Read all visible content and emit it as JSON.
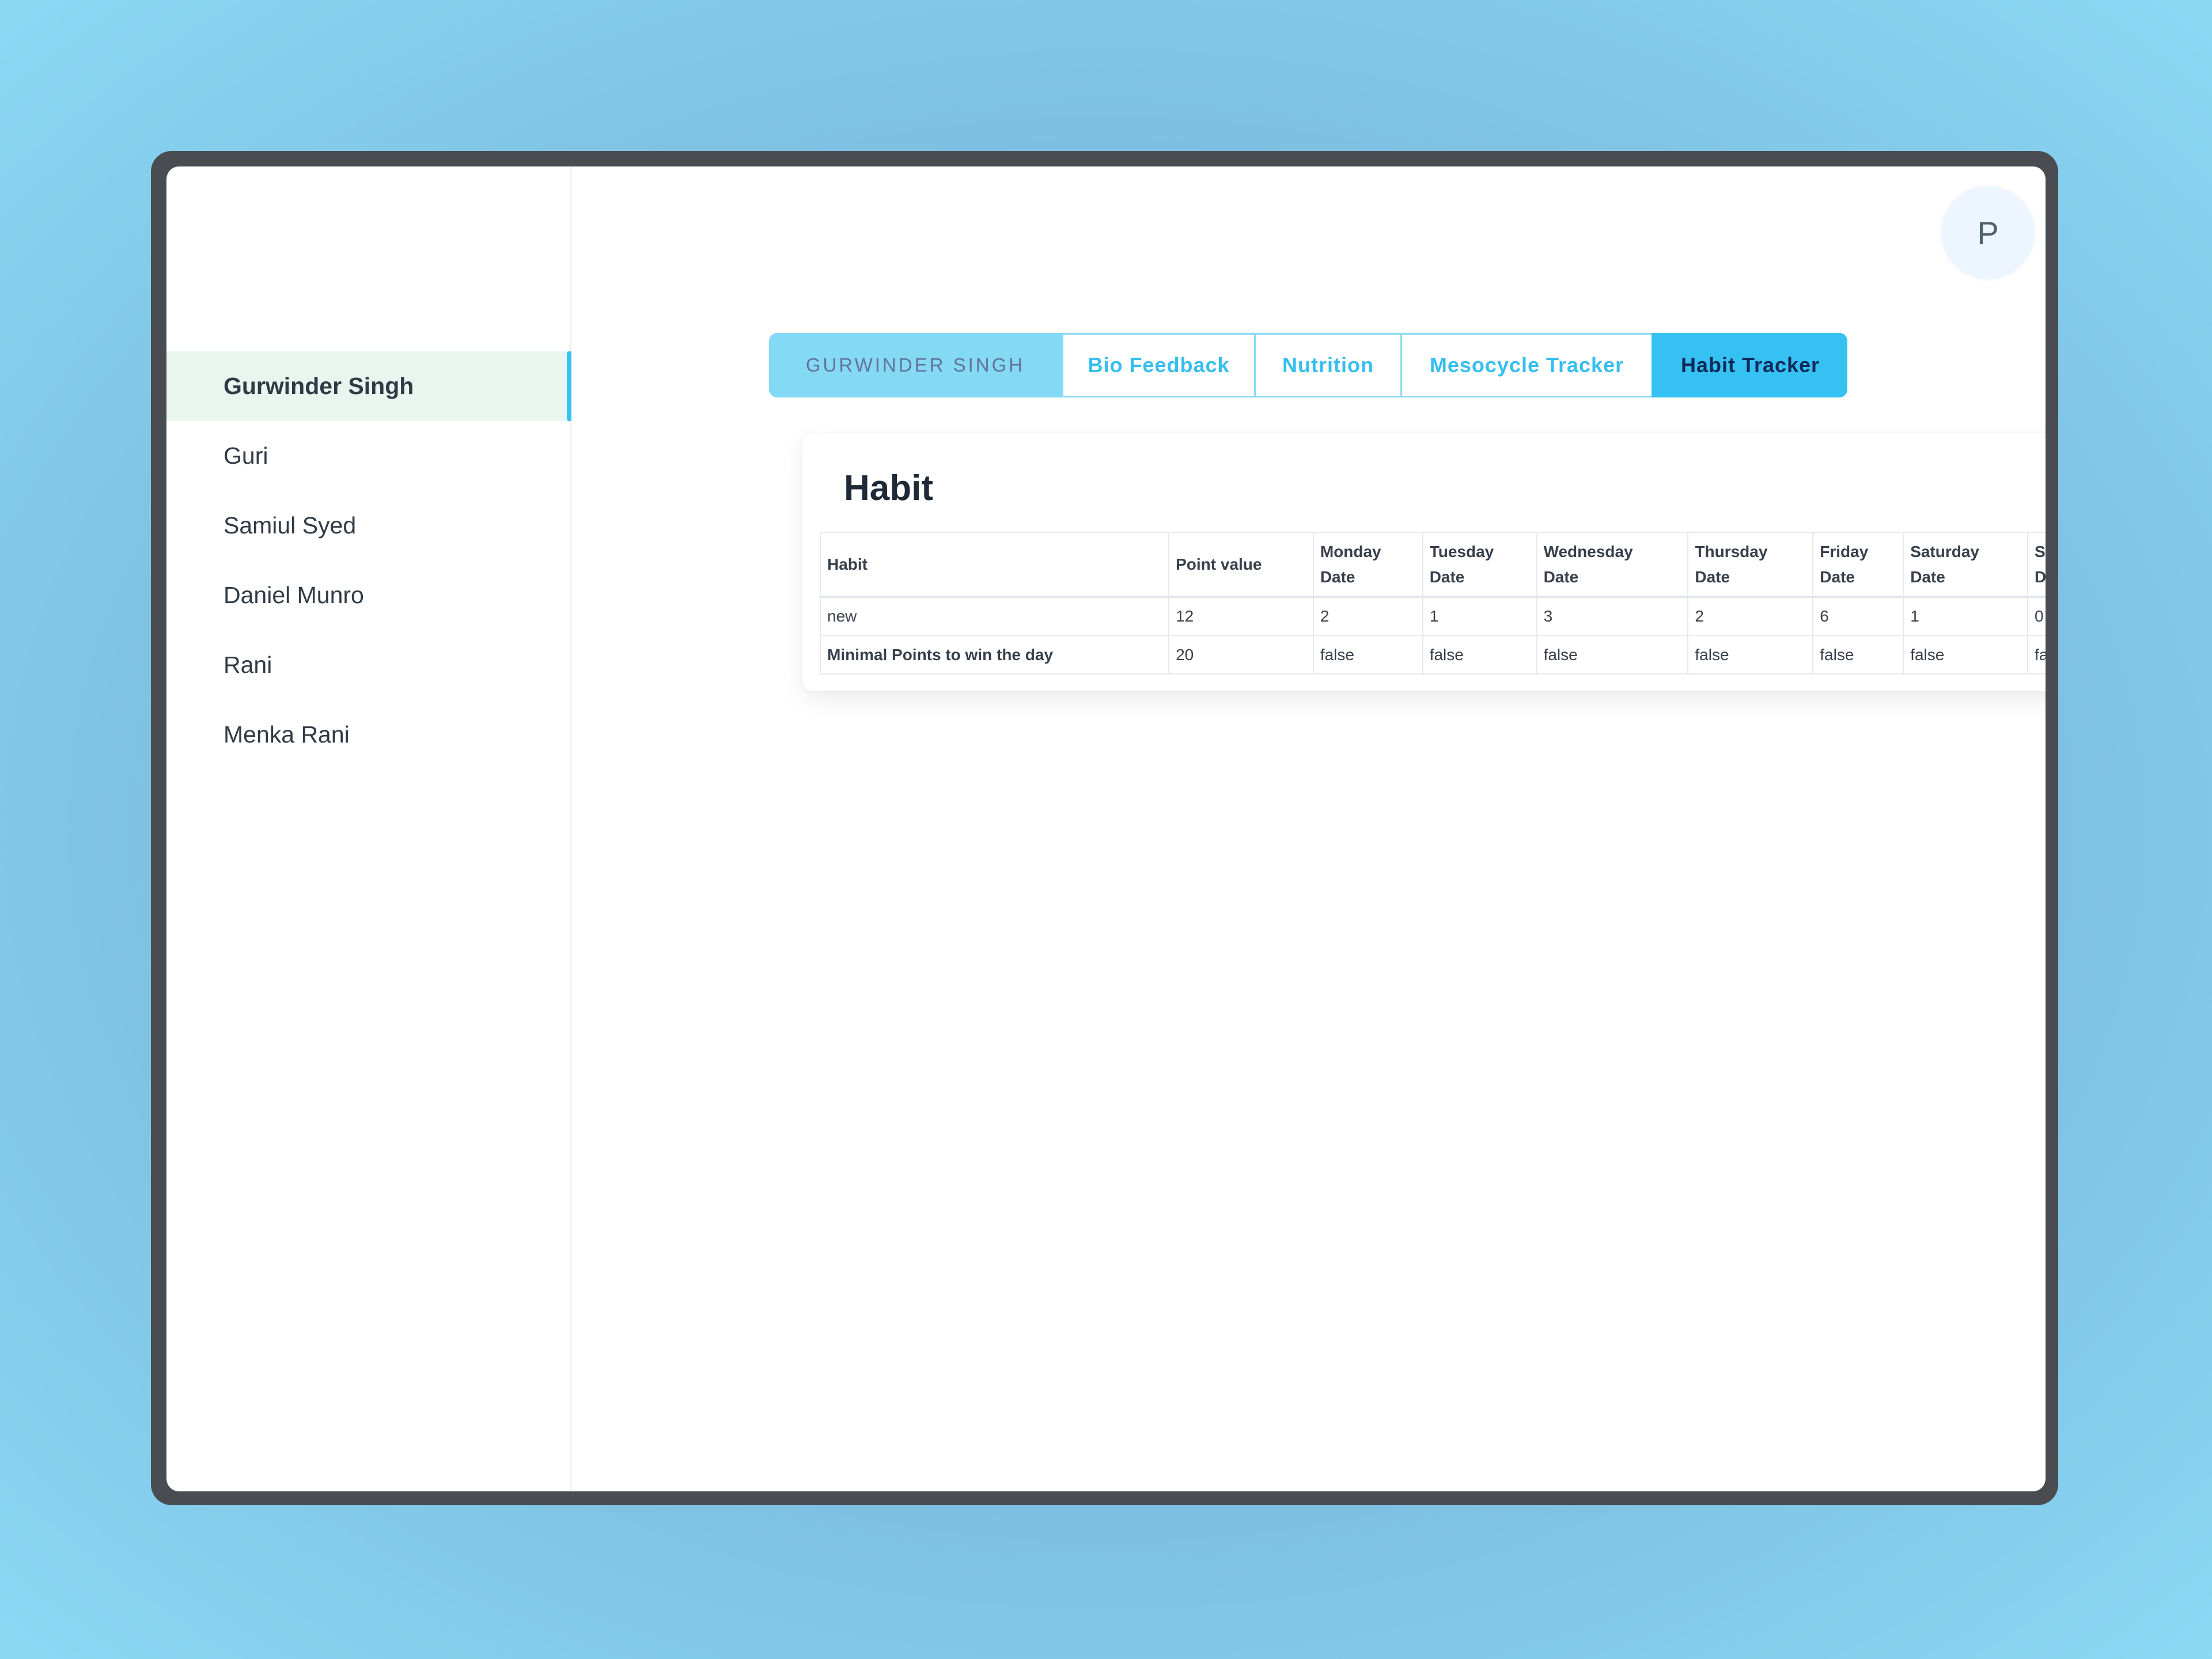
{
  "sidebar": {
    "items": [
      {
        "label": "Gurwinder Singh",
        "active": true
      },
      {
        "label": "Guri"
      },
      {
        "label": "Samiul Syed"
      },
      {
        "label": "Daniel Munro"
      },
      {
        "label": "Rani"
      },
      {
        "label": "Menka Rani"
      }
    ]
  },
  "header": {
    "avatar_initial": "P"
  },
  "tabs": {
    "client_name": "GURWINDER SINGH",
    "items": [
      {
        "label": "Bio Feedback"
      },
      {
        "label": "Nutrition"
      },
      {
        "label": "Mesocycle Tracker"
      },
      {
        "label": "Habit Tracker",
        "active": true
      }
    ]
  },
  "colors": {
    "accent": "#35c2f2",
    "accent_light": "#84d9f5",
    "active_sidebar_bg": "#e8f6ef",
    "frame": "#494c50"
  },
  "habit_card": {
    "title": "Habit",
    "columns": [
      {
        "line1": "Habit",
        "line2": ""
      },
      {
        "line1": "Point value",
        "line2": ""
      },
      {
        "line1": "Monday",
        "line2": "Date"
      },
      {
        "line1": "Tuesday",
        "line2": "Date"
      },
      {
        "line1": "Wednesday",
        "line2": "Date"
      },
      {
        "line1": "Thursday",
        "line2": "Date"
      },
      {
        "line1": "Friday",
        "line2": "Date"
      },
      {
        "line1": "Saturday",
        "line2": "Date"
      },
      {
        "line1": "Sunday",
        "line2": "Date"
      }
    ],
    "rows": [
      [
        "new",
        "12",
        "2",
        "1",
        "3",
        "2",
        "6",
        "1",
        "0"
      ],
      [
        "Minimal Points to win the day",
        "20",
        "false",
        "false",
        "false",
        "false",
        "false",
        "false",
        "false"
      ]
    ]
  }
}
